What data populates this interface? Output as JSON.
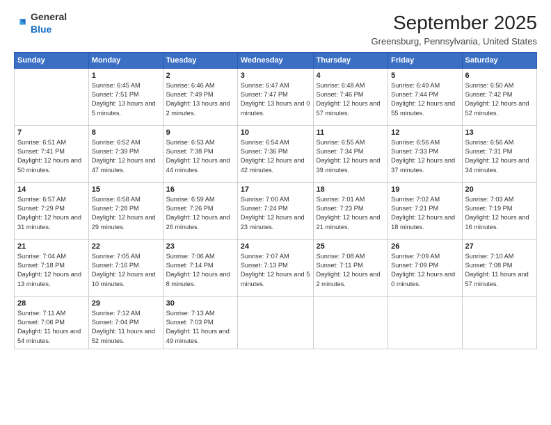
{
  "logo": {
    "general": "General",
    "blue": "Blue"
  },
  "title": "September 2025",
  "location": "Greensburg, Pennsylvania, United States",
  "weekdays": [
    "Sunday",
    "Monday",
    "Tuesday",
    "Wednesday",
    "Thursday",
    "Friday",
    "Saturday"
  ],
  "weeks": [
    [
      {
        "day": "",
        "sunrise": "",
        "sunset": "",
        "daylight": ""
      },
      {
        "day": "1",
        "sunrise": "Sunrise: 6:45 AM",
        "sunset": "Sunset: 7:51 PM",
        "daylight": "Daylight: 13 hours and 5 minutes."
      },
      {
        "day": "2",
        "sunrise": "Sunrise: 6:46 AM",
        "sunset": "Sunset: 7:49 PM",
        "daylight": "Daylight: 13 hours and 2 minutes."
      },
      {
        "day": "3",
        "sunrise": "Sunrise: 6:47 AM",
        "sunset": "Sunset: 7:47 PM",
        "daylight": "Daylight: 13 hours and 0 minutes."
      },
      {
        "day": "4",
        "sunrise": "Sunrise: 6:48 AM",
        "sunset": "Sunset: 7:46 PM",
        "daylight": "Daylight: 12 hours and 57 minutes."
      },
      {
        "day": "5",
        "sunrise": "Sunrise: 6:49 AM",
        "sunset": "Sunset: 7:44 PM",
        "daylight": "Daylight: 12 hours and 55 minutes."
      },
      {
        "day": "6",
        "sunrise": "Sunrise: 6:50 AM",
        "sunset": "Sunset: 7:42 PM",
        "daylight": "Daylight: 12 hours and 52 minutes."
      }
    ],
    [
      {
        "day": "7",
        "sunrise": "Sunrise: 6:51 AM",
        "sunset": "Sunset: 7:41 PM",
        "daylight": "Daylight: 12 hours and 50 minutes."
      },
      {
        "day": "8",
        "sunrise": "Sunrise: 6:52 AM",
        "sunset": "Sunset: 7:39 PM",
        "daylight": "Daylight: 12 hours and 47 minutes."
      },
      {
        "day": "9",
        "sunrise": "Sunrise: 6:53 AM",
        "sunset": "Sunset: 7:38 PM",
        "daylight": "Daylight: 12 hours and 44 minutes."
      },
      {
        "day": "10",
        "sunrise": "Sunrise: 6:54 AM",
        "sunset": "Sunset: 7:36 PM",
        "daylight": "Daylight: 12 hours and 42 minutes."
      },
      {
        "day": "11",
        "sunrise": "Sunrise: 6:55 AM",
        "sunset": "Sunset: 7:34 PM",
        "daylight": "Daylight: 12 hours and 39 minutes."
      },
      {
        "day": "12",
        "sunrise": "Sunrise: 6:56 AM",
        "sunset": "Sunset: 7:33 PM",
        "daylight": "Daylight: 12 hours and 37 minutes."
      },
      {
        "day": "13",
        "sunrise": "Sunrise: 6:56 AM",
        "sunset": "Sunset: 7:31 PM",
        "daylight": "Daylight: 12 hours and 34 minutes."
      }
    ],
    [
      {
        "day": "14",
        "sunrise": "Sunrise: 6:57 AM",
        "sunset": "Sunset: 7:29 PM",
        "daylight": "Daylight: 12 hours and 31 minutes."
      },
      {
        "day": "15",
        "sunrise": "Sunrise: 6:58 AM",
        "sunset": "Sunset: 7:28 PM",
        "daylight": "Daylight: 12 hours and 29 minutes."
      },
      {
        "day": "16",
        "sunrise": "Sunrise: 6:59 AM",
        "sunset": "Sunset: 7:26 PM",
        "daylight": "Daylight: 12 hours and 26 minutes."
      },
      {
        "day": "17",
        "sunrise": "Sunrise: 7:00 AM",
        "sunset": "Sunset: 7:24 PM",
        "daylight": "Daylight: 12 hours and 23 minutes."
      },
      {
        "day": "18",
        "sunrise": "Sunrise: 7:01 AM",
        "sunset": "Sunset: 7:23 PM",
        "daylight": "Daylight: 12 hours and 21 minutes."
      },
      {
        "day": "19",
        "sunrise": "Sunrise: 7:02 AM",
        "sunset": "Sunset: 7:21 PM",
        "daylight": "Daylight: 12 hours and 18 minutes."
      },
      {
        "day": "20",
        "sunrise": "Sunrise: 7:03 AM",
        "sunset": "Sunset: 7:19 PM",
        "daylight": "Daylight: 12 hours and 16 minutes."
      }
    ],
    [
      {
        "day": "21",
        "sunrise": "Sunrise: 7:04 AM",
        "sunset": "Sunset: 7:18 PM",
        "daylight": "Daylight: 12 hours and 13 minutes."
      },
      {
        "day": "22",
        "sunrise": "Sunrise: 7:05 AM",
        "sunset": "Sunset: 7:16 PM",
        "daylight": "Daylight: 12 hours and 10 minutes."
      },
      {
        "day": "23",
        "sunrise": "Sunrise: 7:06 AM",
        "sunset": "Sunset: 7:14 PM",
        "daylight": "Daylight: 12 hours and 8 minutes."
      },
      {
        "day": "24",
        "sunrise": "Sunrise: 7:07 AM",
        "sunset": "Sunset: 7:13 PM",
        "daylight": "Daylight: 12 hours and 5 minutes."
      },
      {
        "day": "25",
        "sunrise": "Sunrise: 7:08 AM",
        "sunset": "Sunset: 7:11 PM",
        "daylight": "Daylight: 12 hours and 2 minutes."
      },
      {
        "day": "26",
        "sunrise": "Sunrise: 7:09 AM",
        "sunset": "Sunset: 7:09 PM",
        "daylight": "Daylight: 12 hours and 0 minutes."
      },
      {
        "day": "27",
        "sunrise": "Sunrise: 7:10 AM",
        "sunset": "Sunset: 7:08 PM",
        "daylight": "Daylight: 11 hours and 57 minutes."
      }
    ],
    [
      {
        "day": "28",
        "sunrise": "Sunrise: 7:11 AM",
        "sunset": "Sunset: 7:06 PM",
        "daylight": "Daylight: 11 hours and 54 minutes."
      },
      {
        "day": "29",
        "sunrise": "Sunrise: 7:12 AM",
        "sunset": "Sunset: 7:04 PM",
        "daylight": "Daylight: 11 hours and 52 minutes."
      },
      {
        "day": "30",
        "sunrise": "Sunrise: 7:13 AM",
        "sunset": "Sunset: 7:03 PM",
        "daylight": "Daylight: 11 hours and 49 minutes."
      },
      {
        "day": "",
        "sunrise": "",
        "sunset": "",
        "daylight": ""
      },
      {
        "day": "",
        "sunrise": "",
        "sunset": "",
        "daylight": ""
      },
      {
        "day": "",
        "sunrise": "",
        "sunset": "",
        "daylight": ""
      },
      {
        "day": "",
        "sunrise": "",
        "sunset": "",
        "daylight": ""
      }
    ]
  ]
}
